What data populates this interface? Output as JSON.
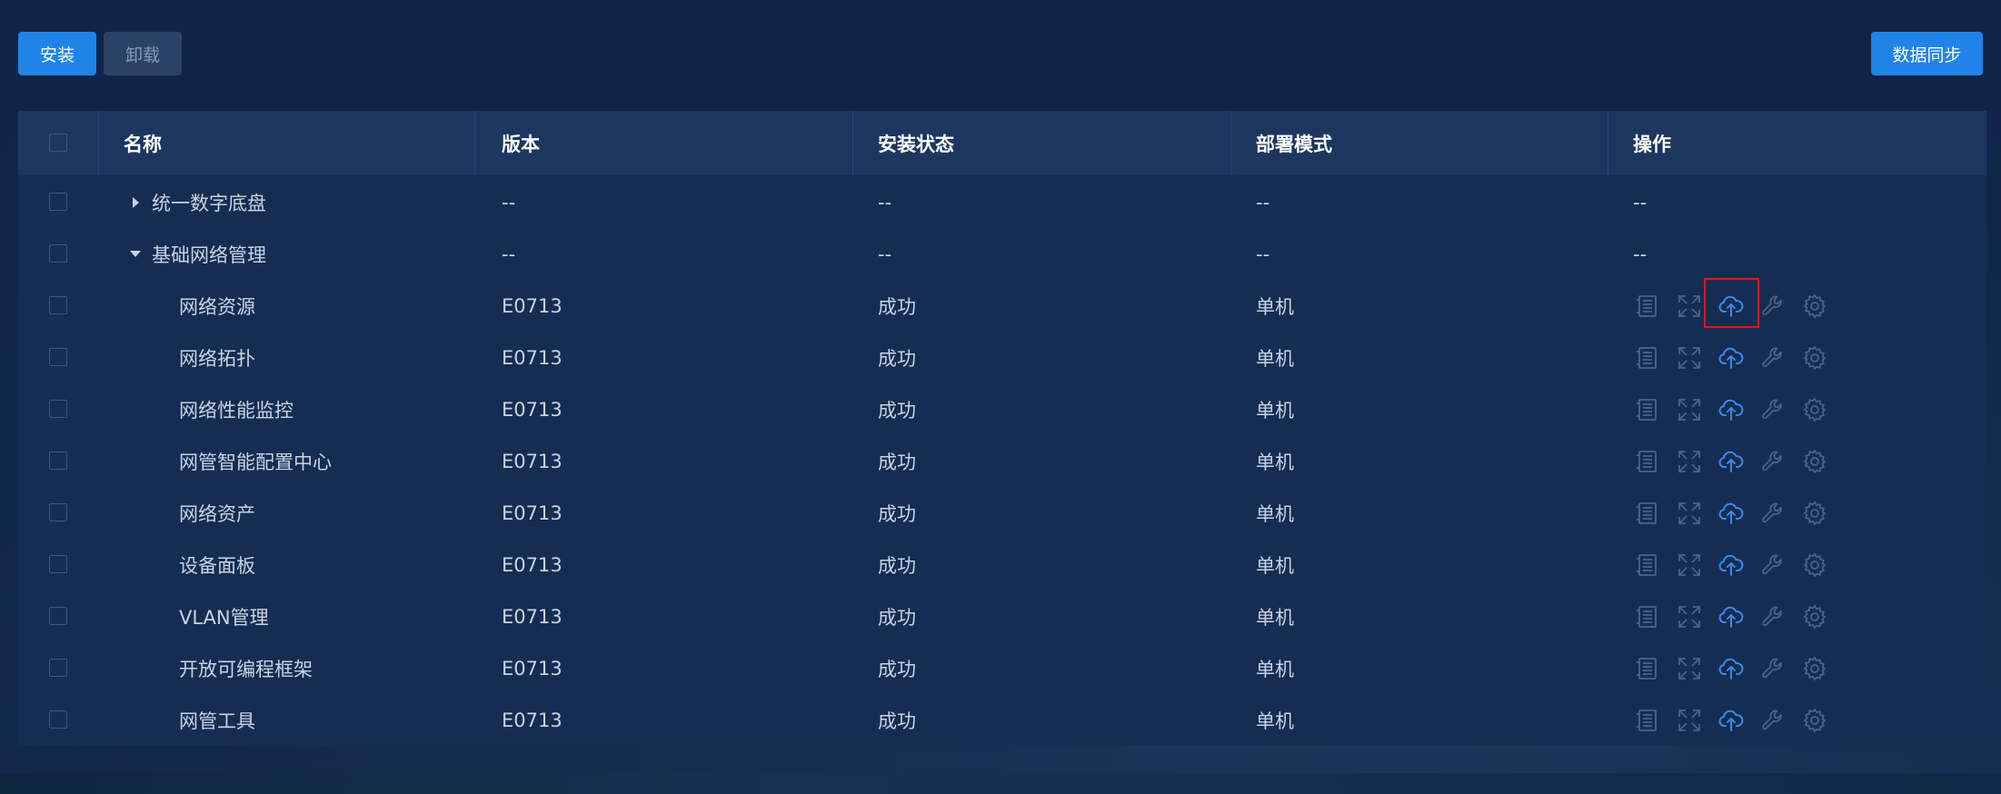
{
  "toolbar": {
    "install_label": "安装",
    "uninstall_label": "卸载",
    "sync_label": "数据同步"
  },
  "table": {
    "headers": {
      "name": "名称",
      "version": "版本",
      "status": "安装状态",
      "mode": "部署模式",
      "ops": "操作"
    },
    "groups": [
      {
        "name": "统一数字底盘",
        "version": "--",
        "status": "--",
        "mode": "--",
        "ops": "--",
        "expanded": false
      },
      {
        "name": "基础网络管理",
        "version": "--",
        "status": "--",
        "mode": "--",
        "ops": "--",
        "expanded": true
      }
    ],
    "rows": [
      {
        "name": "网络资源",
        "version": "E0713",
        "status": "成功",
        "mode": "单机"
      },
      {
        "name": "网络拓扑",
        "version": "E0713",
        "status": "成功",
        "mode": "单机"
      },
      {
        "name": "网络性能监控",
        "version": "E0713",
        "status": "成功",
        "mode": "单机"
      },
      {
        "name": "网管智能配置中心",
        "version": "E0713",
        "status": "成功",
        "mode": "单机"
      },
      {
        "name": "网络资产",
        "version": "E0713",
        "status": "成功",
        "mode": "单机"
      },
      {
        "name": "设备面板",
        "version": "E0713",
        "status": "成功",
        "mode": "单机"
      },
      {
        "name": "VLAN管理",
        "version": "E0713",
        "status": "成功",
        "mode": "单机"
      },
      {
        "name": "开放可编程框架",
        "version": "E0713",
        "status": "成功",
        "mode": "单机"
      },
      {
        "name": "网管工具",
        "version": "E0713",
        "status": "成功",
        "mode": "单机"
      }
    ],
    "op_icons": [
      "log-icon",
      "expand-icon",
      "upload-cloud-icon",
      "wrench-icon",
      "gear-icon"
    ]
  },
  "colors": {
    "primary": "#2083e8",
    "upload_icon": "#3d8cf0",
    "muted_icon": "#4d6285",
    "highlight": "#e0141d"
  }
}
